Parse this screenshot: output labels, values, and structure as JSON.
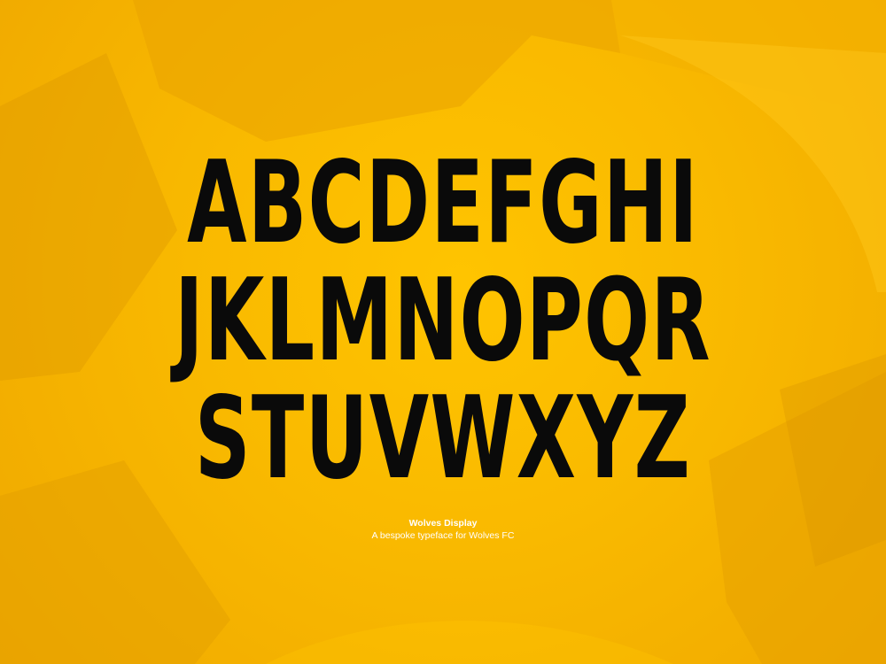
{
  "background_color": "#f7b500",
  "text_color": "#0a0a0a",
  "caption_color": "#ffffff",
  "alphabet": {
    "row1": "ABCDEFGHI",
    "row2": "JKLMNOPQR",
    "row3": "STUVWXYZ"
  },
  "caption": {
    "title": "Wolves Display",
    "subtitle": "A bespoke typeface for Wolves FC"
  }
}
